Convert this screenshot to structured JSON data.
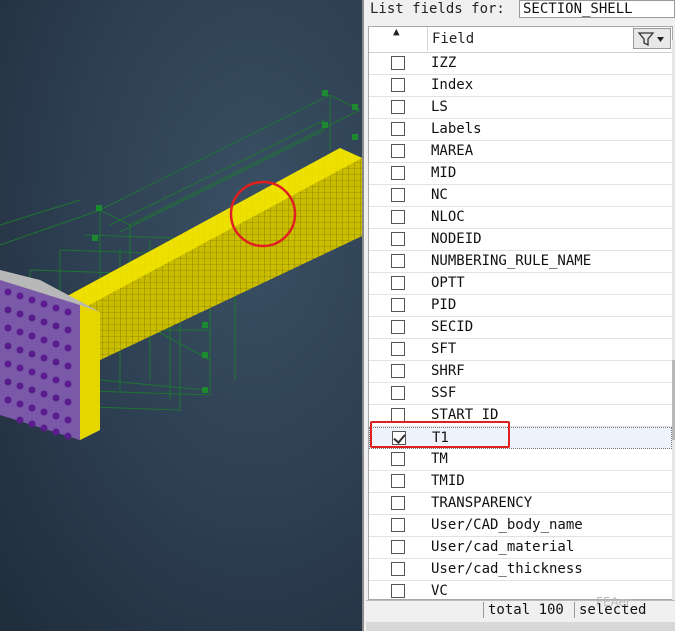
{
  "panel": {
    "list_label": "List fields for:",
    "entity_type": "SECTION_SHELL",
    "column_header": "Field",
    "sort_indicator": "▲",
    "filter_icon": "filter-icon",
    "rows": [
      {
        "label": "IZZ",
        "checked": false
      },
      {
        "label": "Index",
        "checked": false
      },
      {
        "label": "LS",
        "checked": false
      },
      {
        "label": "Labels",
        "checked": false
      },
      {
        "label": "MAREA",
        "checked": false
      },
      {
        "label": "MID",
        "checked": false
      },
      {
        "label": "NC",
        "checked": false
      },
      {
        "label": "NLOC",
        "checked": false
      },
      {
        "label": "NODEID",
        "checked": false
      },
      {
        "label": "NUMBERING_RULE_NAME",
        "checked": false
      },
      {
        "label": "OPTT",
        "checked": false
      },
      {
        "label": "PID",
        "checked": false
      },
      {
        "label": "SECID",
        "checked": false
      },
      {
        "label": "SFT",
        "checked": false
      },
      {
        "label": "SHRF",
        "checked": false
      },
      {
        "label": "SSF",
        "checked": false
      },
      {
        "label": "START_ID",
        "checked": false
      },
      {
        "label": "T1",
        "checked": true
      },
      {
        "label": "TM",
        "checked": false
      },
      {
        "label": "TMID",
        "checked": false
      },
      {
        "label": "TRANSPARENCY",
        "checked": false
      },
      {
        "label": "User/CAD_body_name",
        "checked": false
      },
      {
        "label": "User/cad_material",
        "checked": false
      },
      {
        "label": "User/cad_thickness",
        "checked": false
      },
      {
        "label": "VC",
        "checked": false
      }
    ],
    "footer": {
      "total": "total 100",
      "selected": "selected"
    }
  },
  "watermark": "FEAer",
  "colors": {
    "highlight": "#e02020",
    "mesh_yellow": "#e8d800",
    "node_purple": "#6a2a9a",
    "wire_green": "#1e6a2e"
  }
}
